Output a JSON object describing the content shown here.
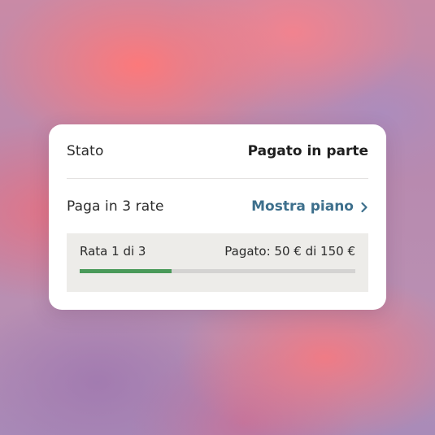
{
  "status": {
    "label": "Stato",
    "value": "Pagato in parte"
  },
  "installments": {
    "label": "Paga in 3 rate",
    "link_label": "Mostra piano",
    "link_icon": "chevron-right-icon",
    "link_color": "#3d6f8c"
  },
  "progress": {
    "installment_text": "Rata 1 di 3",
    "paid_text": "Pagato: 50 € di 150 €",
    "fraction": 0.333,
    "fill_color": "#4a9a5a",
    "track_color": "#d4d3d2"
  }
}
